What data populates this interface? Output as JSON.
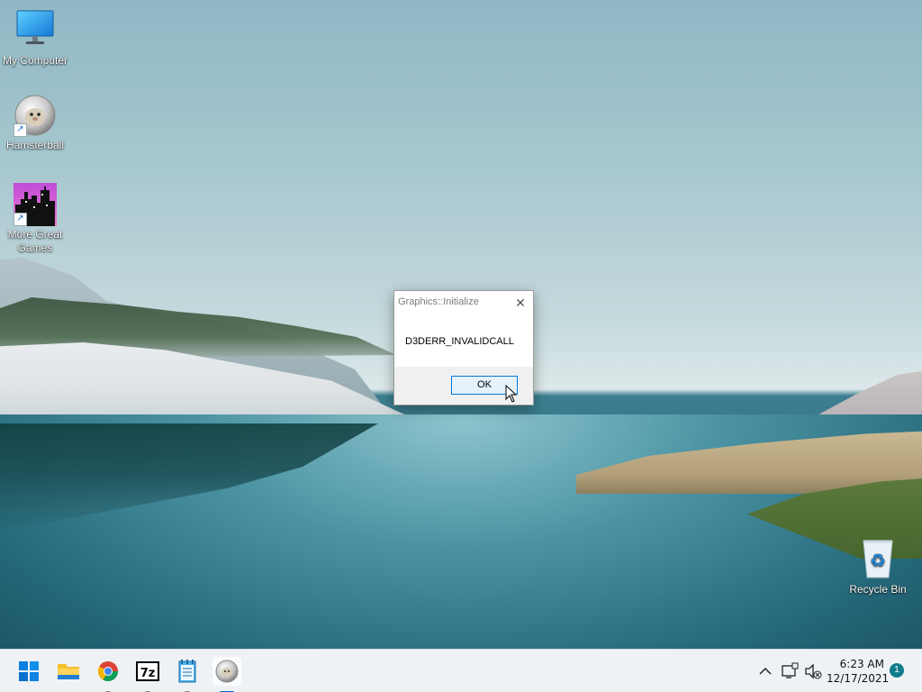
{
  "desktop": {
    "icons": [
      {
        "label": "My Computer",
        "icon": "monitor-icon"
      },
      {
        "label": "Hamsterball",
        "icon": "hamsterball-icon"
      },
      {
        "label": "More Great Games",
        "icon": "city-night-icon"
      },
      {
        "label": "Recycle Bin",
        "icon": "recycle-bin-icon"
      }
    ]
  },
  "dialog": {
    "title": "Graphics::Initialize",
    "close_label": "✕",
    "message": "D3DERR_INVALIDCALL",
    "ok_label": "OK"
  },
  "taskbar": {
    "apps": [
      {
        "name": "Start",
        "icon": "windows-start-icon",
        "running": false
      },
      {
        "name": "File Explorer",
        "icon": "folder-icon",
        "running": false
      },
      {
        "name": "Google Chrome",
        "icon": "chrome-icon",
        "running": true
      },
      {
        "name": "7-Zip",
        "icon": "7zip-icon",
        "running": true
      },
      {
        "name": "Notepad",
        "icon": "notepad-icon",
        "running": true
      },
      {
        "name": "Hamsterball",
        "icon": "hamsterball-icon",
        "running": true,
        "active": true
      }
    ],
    "tray": {
      "time": "6:23 AM",
      "date": "12/17/2021",
      "notification_count": "1"
    }
  },
  "colors": {
    "accent": "#0078d7",
    "taskbar_bg": "#eef2f5",
    "badge": "#117d8b"
  }
}
